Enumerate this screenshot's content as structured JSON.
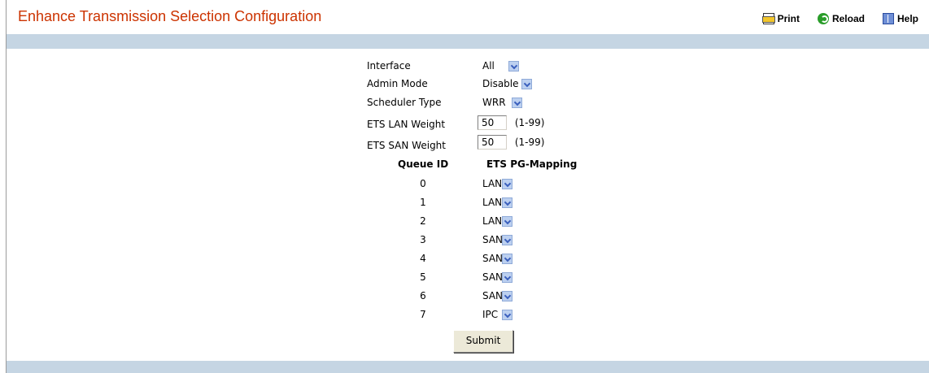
{
  "header": {
    "title": "Enhance Transmission Selection Configuration",
    "print_label": "Print",
    "reload_label": "Reload",
    "help_label": "Help"
  },
  "form": {
    "interface": {
      "label": "Interface",
      "value": "All"
    },
    "admin_mode": {
      "label": "Admin Mode",
      "value": "Disable"
    },
    "scheduler_type": {
      "label": "Scheduler Type",
      "value": "WRR"
    },
    "ets_lan_weight": {
      "label": "ETS LAN Weight",
      "value": "50",
      "range": "(1-99)"
    },
    "ets_san_weight": {
      "label": "ETS SAN Weight",
      "value": "50",
      "range": "(1-99)"
    }
  },
  "mapping": {
    "col_queue": "Queue ID",
    "col_pg": "ETS PG-Mapping",
    "rows": [
      {
        "queue": "0",
        "pg": "LAN"
      },
      {
        "queue": "1",
        "pg": "LAN"
      },
      {
        "queue": "2",
        "pg": "LAN"
      },
      {
        "queue": "3",
        "pg": "SAN"
      },
      {
        "queue": "4",
        "pg": "SAN"
      },
      {
        "queue": "5",
        "pg": "SAN"
      },
      {
        "queue": "6",
        "pg": "SAN"
      },
      {
        "queue": "7",
        "pg": "IPC"
      }
    ]
  },
  "submit_label": "Submit",
  "colors": {
    "title": "#cc3300",
    "bar": "#c5d5e3"
  },
  "icons": {
    "print": "printer-icon",
    "reload": "reload-icon",
    "help": "book-icon",
    "dropdown": "chevron-down-icon"
  }
}
